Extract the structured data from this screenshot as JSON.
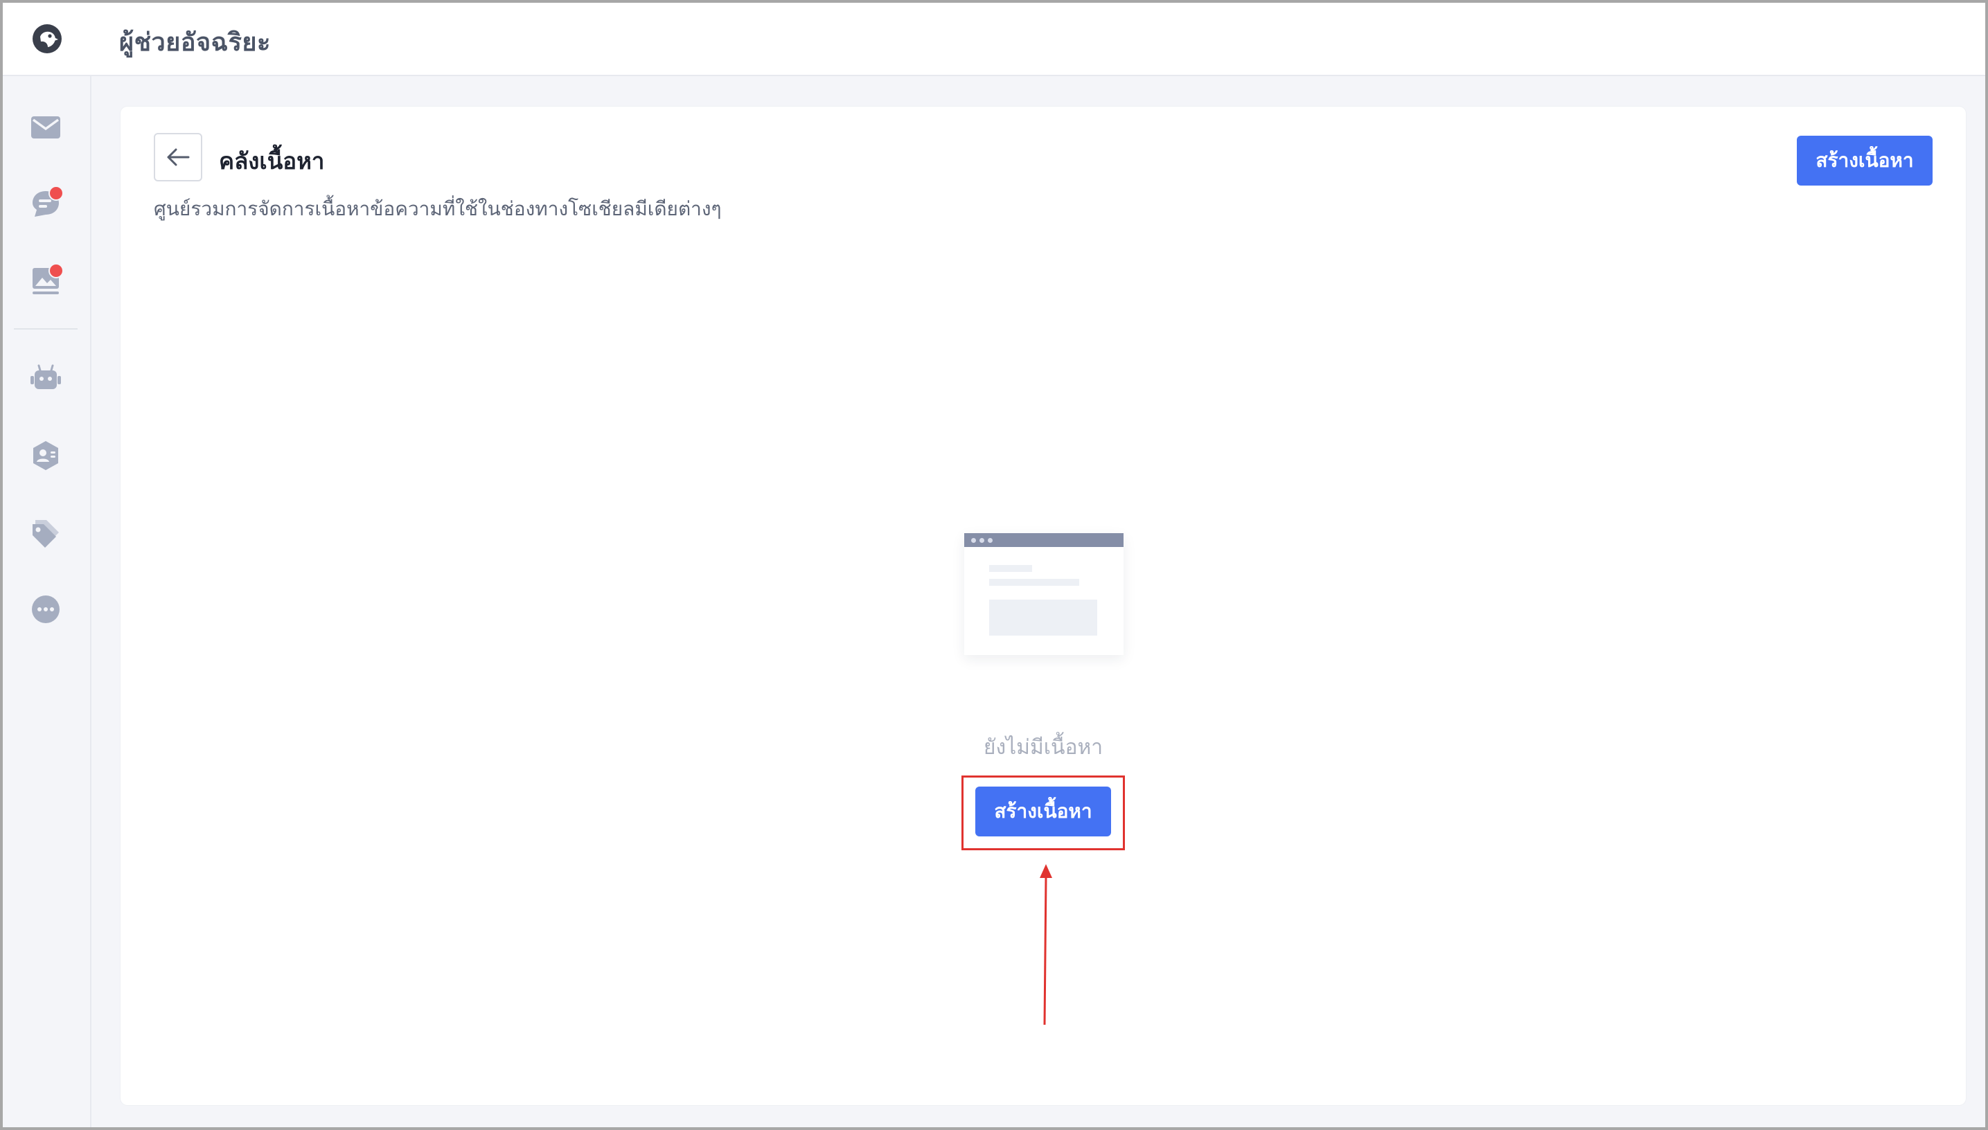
{
  "app": {
    "title": "ผู้ช่วยอัจฉริยะ"
  },
  "sidebar": {
    "logo_icon": "parrot-logo-icon",
    "items": [
      {
        "icon": "envelope-icon",
        "badge": false
      },
      {
        "icon": "chat-bubble-icon",
        "badge": true
      },
      {
        "icon": "image-gallery-icon",
        "badge": true
      },
      {
        "icon": "robot-icon",
        "badge": false
      },
      {
        "icon": "user-badge-icon",
        "badge": false
      },
      {
        "icon": "tags-icon",
        "badge": false
      },
      {
        "icon": "more-icon",
        "badge": false
      }
    ]
  },
  "page": {
    "title": "คลังเนื้อหา",
    "subtitle": "ศูนย์รวมการจัดการเนื้อหาข้อความที่ใช้ในช่องทางโซเชียลมีเดียต่างๆ",
    "create_button_label": "สร้างเนื้อหา"
  },
  "empty_state": {
    "message": "ยังไม่มีเนื้อหา",
    "create_button_label": "สร้างเนื้อหา"
  },
  "colors": {
    "primary": "#4472f3",
    "highlight": "#e0332f",
    "badge": "#ef4f4f",
    "sidebar_icon": "#a5adc0"
  }
}
